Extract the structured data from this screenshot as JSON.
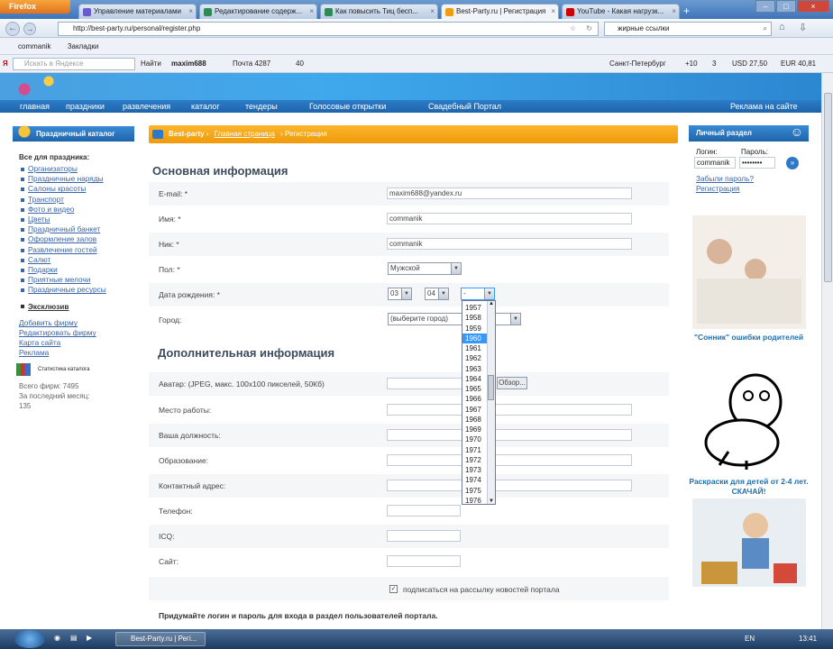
{
  "browser": {
    "firefox_label": "Firefox",
    "tabs": [
      {
        "label": "Управление материалами",
        "fav": "#6a5acd"
      },
      {
        "label": "Редактирование содерж...",
        "fav": "#2e8b57"
      },
      {
        "label": "Как повысить Тиц бесп...",
        "fav": "#2e8b57"
      },
      {
        "label": "Best-Party.ru | Регистрация",
        "fav": "#f39c12"
      },
      {
        "label": "YouTube - Какая нагрузк...",
        "fav": "#cc0000"
      }
    ],
    "url": "http://best-party.ru/personal/register.php",
    "search": "жирные ссылки",
    "bookmarks": [
      "commanik",
      "Закладки"
    ],
    "yandex_bar": {
      "search_placeholder": "Искать в Яндексе",
      "find": "Найти",
      "user": "maxim688",
      "mail": "Почта 4287",
      "count40": "40",
      "city": "Санкт-Петербург",
      "temp": "+10",
      "traffic": "3",
      "usd": "USD 27,50",
      "eur": "EUR 40,81"
    }
  },
  "site": {
    "menu": [
      "главная",
      "праздники",
      "развлечения",
      "каталог",
      "тендеры",
      "Голосовые открытки",
      "Свадебный Портал",
      "Реклама на сайте"
    ],
    "left": {
      "title": "Праздничный каталог",
      "section_head": "Все для праздника:",
      "links": [
        "Организаторы",
        "Праздничные наряды",
        "Салоны красоты",
        "Транспорт",
        "Фото и видео",
        "Цветы",
        "Праздничный банкет",
        "Оформление залов",
        "Развлечение гостей",
        "Салют",
        "Подарки",
        "Приятные мелочи",
        "Праздничные ресурсы"
      ],
      "exclusive": "Эксклюзив",
      "links2": [
        "Добавить фирму",
        "Редактировать фирму",
        "Карта сайта",
        "Реклама"
      ],
      "stat_label": "Статистика каталога",
      "stats": [
        "Всего фирм: 7495",
        "За последний месяц:",
        "135"
      ]
    },
    "breadcrumb": {
      "site": "Best-party",
      "home": "Главная страница",
      "current": "Регистрация"
    },
    "form": {
      "basic_title": "Основная информация",
      "email_label": "E-mail: *",
      "email_value": "maxim688@yandex.ru",
      "name_label": "Имя: *",
      "name_value": "commanik",
      "nick_label": "Ник: *",
      "nick_value": "commanik",
      "gender_label": "Пол: *",
      "gender_value": "Мужской",
      "birth_label": "Дата рождения: *",
      "birth_day": "03",
      "birth_month": "04",
      "birth_year": "-",
      "city_label": "Город:",
      "city_value": "(выберите город)",
      "extra_title": "Дополнительная информация",
      "avatar_label": "Аватар: (JPEG, макс. 100x100 пикселей, 50Кб)",
      "browse_label": "Обзор...",
      "work_label": "Место работы:",
      "position_label": "Ваша должность:",
      "education_label": "Образование:",
      "address_label": "Контактный адрес:",
      "phone_label": "Телефон:",
      "icq_label": "ICQ:",
      "site_label": "Сайт:",
      "subscribe_label": "подписаться на рассылку новостей портала",
      "bottom_note": "Придумайте логин и пароль для входа в раздел пользователей портала."
    },
    "year_options": [
      "1957",
      "1958",
      "1959",
      "1960",
      "1961",
      "1962",
      "1963",
      "1964",
      "1965",
      "1966",
      "1967",
      "1968",
      "1969",
      "1970",
      "1971",
      "1972",
      "1973",
      "1974",
      "1975",
      "1976"
    ],
    "year_highlight": "1960",
    "right": {
      "title": "Личный раздел",
      "login_label": "Логин:",
      "password_label": "Пароль:",
      "login_value": "commanik",
      "password_value": "••••••••",
      "forgot": "Забыли пароль?",
      "register": "Регистрация",
      "ad1_caption": "\"Сонник\" ошибки родителей",
      "ad2_caption": "Раскраски для детей от 2-4 лет. СКАЧАЙ!"
    }
  },
  "taskbar": {
    "item": "Best-Party.ru | Регі...",
    "lang": "EN",
    "clock": "13:41"
  }
}
